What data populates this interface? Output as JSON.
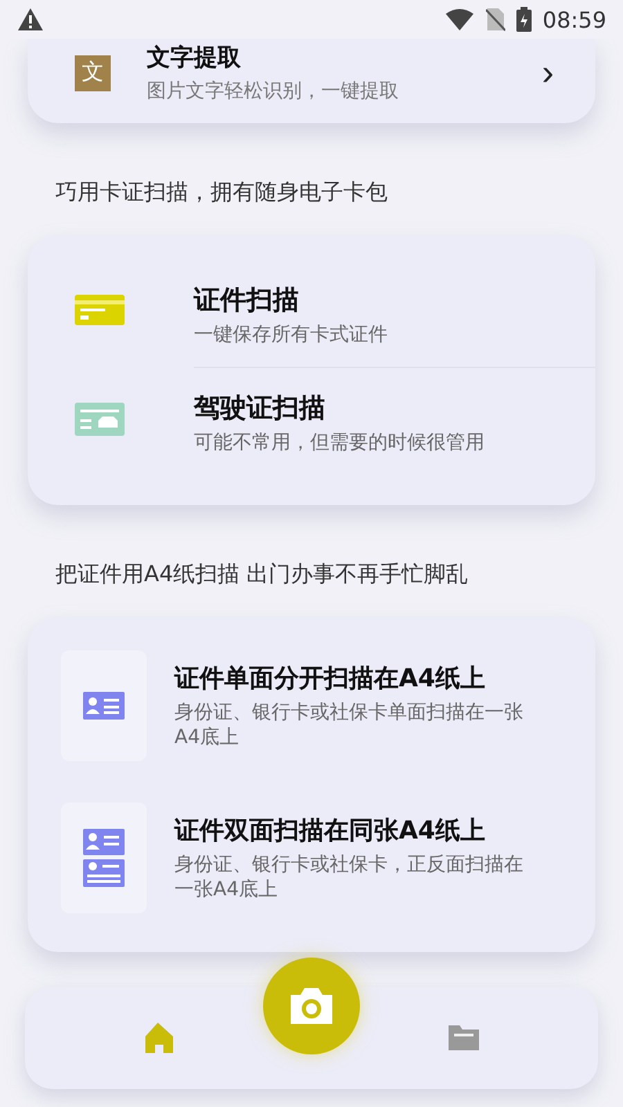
{
  "status_bar": {
    "time": "08:59"
  },
  "top_card": {
    "title": "文字提取",
    "subtitle": "图片文字轻松识别，一键提取",
    "icon_text": "文",
    "chevron": "›"
  },
  "sections": [
    {
      "heading": "巧用卡证扫描，拥有随身电子卡包",
      "kind": "list",
      "items": [
        {
          "kind": "card",
          "title": "证件扫描",
          "subtitle": "一键保存所有卡式证件"
        },
        {
          "kind": "license",
          "title": "驾驶证扫描",
          "subtitle": "可能不常用，但需要的时候很管用"
        }
      ]
    },
    {
      "heading": "把证件用A4纸扫描 出门办事不再手忙脚乱",
      "kind": "tiles",
      "items": [
        {
          "kind": "single",
          "title": "证件单面分开扫描在A4纸上",
          "subtitle": "身份证、银行卡或社保卡单面扫描在一张A4底上"
        },
        {
          "kind": "double",
          "title": "证件双面扫描在同张A4纸上",
          "subtitle": "身份证、银行卡或社保卡，正反面扫描在一张A4底上"
        }
      ]
    }
  ],
  "bottom_nav": [
    {
      "kind": "home",
      "selected": true
    },
    {
      "kind": "files",
      "selected": false
    }
  ]
}
